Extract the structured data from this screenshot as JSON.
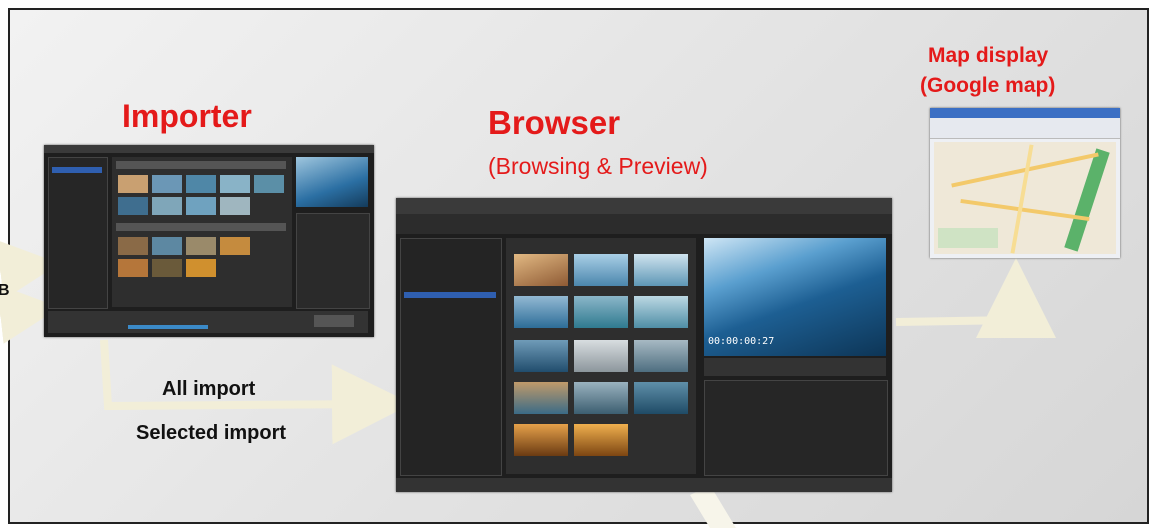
{
  "titles": {
    "importer": "Importer",
    "browser": "Browser",
    "browser_sub": "(Browsing & Preview)",
    "map_line1": "Map display",
    "map_line2": "(Google map)"
  },
  "labels": {
    "all_import": "All import",
    "selected_import": "Selected import",
    "edge_char": "B"
  },
  "preview": {
    "timecode": "00:00:00:27"
  },
  "colors": {
    "title_red": "#e41a1a",
    "arrow": "#f2eed8"
  }
}
